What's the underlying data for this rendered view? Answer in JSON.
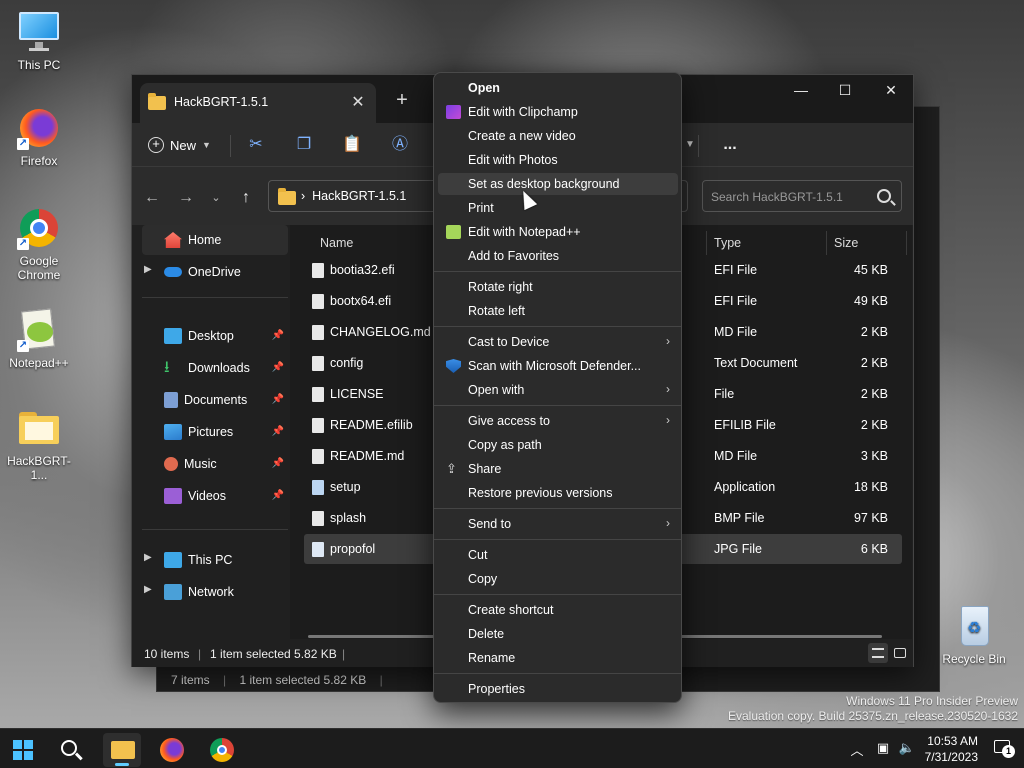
{
  "desktop": {
    "icons": [
      {
        "label": "This PC"
      },
      {
        "label": "Firefox"
      },
      {
        "label": "Google Chrome"
      },
      {
        "label": "Notepad++"
      },
      {
        "label": "HackBGRT-1..."
      },
      {
        "label": "Recycle Bin"
      }
    ],
    "watermark_line1": "Windows 11 Pro Insider Preview",
    "watermark_line2": "Evaluation copy. Build 25375.zn_release.230520-1632"
  },
  "back_window": {
    "status_items": "7 items",
    "status_selected": "1 item selected  5.82 KB"
  },
  "explorer": {
    "tab_title": "HackBGRT-1.5.1",
    "toolbar": {
      "new_label": "New",
      "more_label": "..."
    },
    "address": "HackBGRT-1.5.1",
    "search_placeholder": "Search HackBGRT-1.5.1",
    "sidebar": {
      "home": "Home",
      "onedrive": "OneDrive",
      "quick": [
        "Desktop",
        "Downloads",
        "Documents",
        "Pictures",
        "Music",
        "Videos"
      ],
      "thispc": "This PC",
      "network": "Network"
    },
    "columns": {
      "name": "Name",
      "type": "Type",
      "size": "Size"
    },
    "files": [
      {
        "name": "bootia32.efi",
        "type": "EFI File",
        "size": "45 KB"
      },
      {
        "name": "bootx64.efi",
        "type": "EFI File",
        "size": "49 KB"
      },
      {
        "name": "CHANGELOG.md",
        "type": "MD File",
        "size": "2 KB"
      },
      {
        "name": "config",
        "type": "Text Document",
        "size": "2 KB"
      },
      {
        "name": "LICENSE",
        "type": "File",
        "size": "2 KB"
      },
      {
        "name": "README.efilib",
        "type": "EFILIB File",
        "size": "2 KB"
      },
      {
        "name": "README.md",
        "type": "MD File",
        "size": "3 KB"
      },
      {
        "name": "setup",
        "type": "Application",
        "size": "18 KB"
      },
      {
        "name": "splash",
        "type": "BMP File",
        "size": "97 KB"
      },
      {
        "name": "propofol",
        "type": "JPG File",
        "size": "6 KB"
      }
    ],
    "status_items": "10 items",
    "status_selected": "1 item selected  5.82 KB"
  },
  "context_menu": {
    "items": [
      {
        "label": "Open"
      },
      {
        "label": "Edit with Clipchamp"
      },
      {
        "label": "Create a new video"
      },
      {
        "label": "Edit with Photos"
      },
      {
        "label": "Set as desktop background"
      },
      {
        "label": "Print"
      },
      {
        "label": "Edit with Notepad++"
      },
      {
        "label": "Add to Favorites"
      },
      {
        "label": "Rotate right"
      },
      {
        "label": "Rotate left"
      },
      {
        "label": "Cast to Device"
      },
      {
        "label": "Scan with Microsoft Defender..."
      },
      {
        "label": "Open with"
      },
      {
        "label": "Give access to"
      },
      {
        "label": "Copy as path"
      },
      {
        "label": "Share"
      },
      {
        "label": "Restore previous versions"
      },
      {
        "label": "Send to"
      },
      {
        "label": "Cut"
      },
      {
        "label": "Copy"
      },
      {
        "label": "Create shortcut"
      },
      {
        "label": "Delete"
      },
      {
        "label": "Rename"
      },
      {
        "label": "Properties"
      }
    ]
  },
  "taskbar": {
    "time": "10:53 AM",
    "date": "7/31/2023",
    "notification_count": "1"
  },
  "colors": {
    "accent": "#60cdff",
    "folder": "#f2c14e",
    "menu_bg": "#2b2b2b"
  }
}
